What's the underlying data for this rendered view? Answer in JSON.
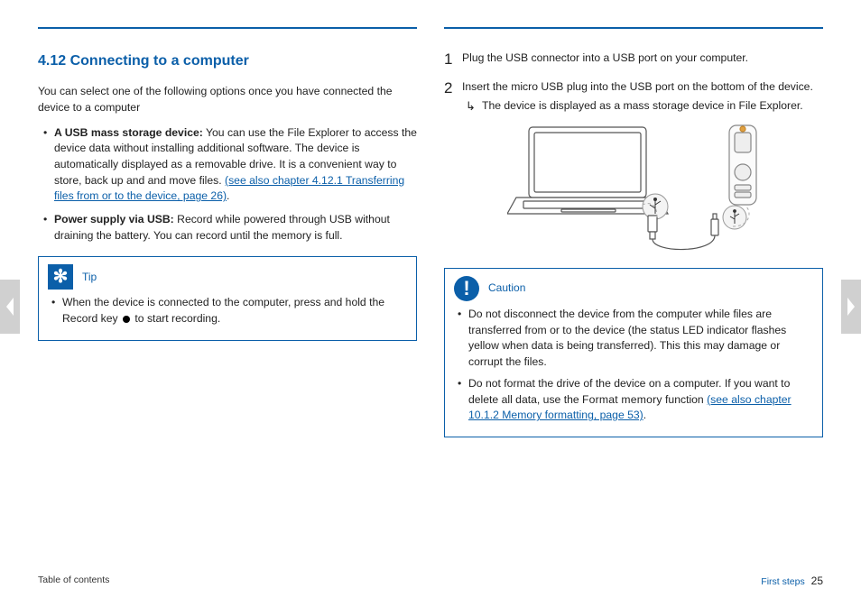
{
  "section": {
    "number": "4.12",
    "title": "Connecting to a computer",
    "heading": "4.12 Connecting to a computer"
  },
  "left": {
    "intro": "You can select one of the following options once you have connected the device to a computer",
    "options": [
      {
        "label": "A USB mass storage device:",
        "body_a": " You can use the File Explorer to access the device data without installing additional software. The device is automatically displayed as a removable drive. It is a convenient way to store, back up and and move files. ",
        "link": "(see also chapter 4.12.1 Transferring files from or to the device, page 26)",
        "body_b": "."
      },
      {
        "label": "Power supply via USB:",
        "body_a": " Record while powered through USB without draining the battery. You can record until the memory is full.",
        "link": "",
        "body_b": ""
      }
    ],
    "tip": {
      "title": "Tip",
      "text_a": "When the device is connected to the computer, press and hold the Record key ",
      "text_b": " to start recording."
    }
  },
  "right": {
    "steps": [
      "Plug the USB connector into a USB port on your computer.",
      "Insert the micro USB plug into the USB port on the bottom of the device."
    ],
    "result": "The device is displayed as a mass storage device in File Explorer.",
    "caution": {
      "title": "Caution",
      "items": [
        {
          "a": "Do not disconnect the device from the computer while files are transferred from or to the device (the status LED indicator flashes yellow when data is being transferred). This this may damage or corrupt the files.",
          "link": ""
        },
        {
          "a": "Do not format the drive of the device on a computer. If you want to delete all data, use the ",
          "fmt": "Format memory",
          "b": " function ",
          "link": "(see also chapter 10.1.2 Memory formatting, page 53)",
          "c": "."
        }
      ]
    }
  },
  "footer": {
    "toc": "Table of contents",
    "chapter": "First steps",
    "page": "25"
  },
  "nav": {
    "prev": "Previous page",
    "next": "Next page"
  }
}
